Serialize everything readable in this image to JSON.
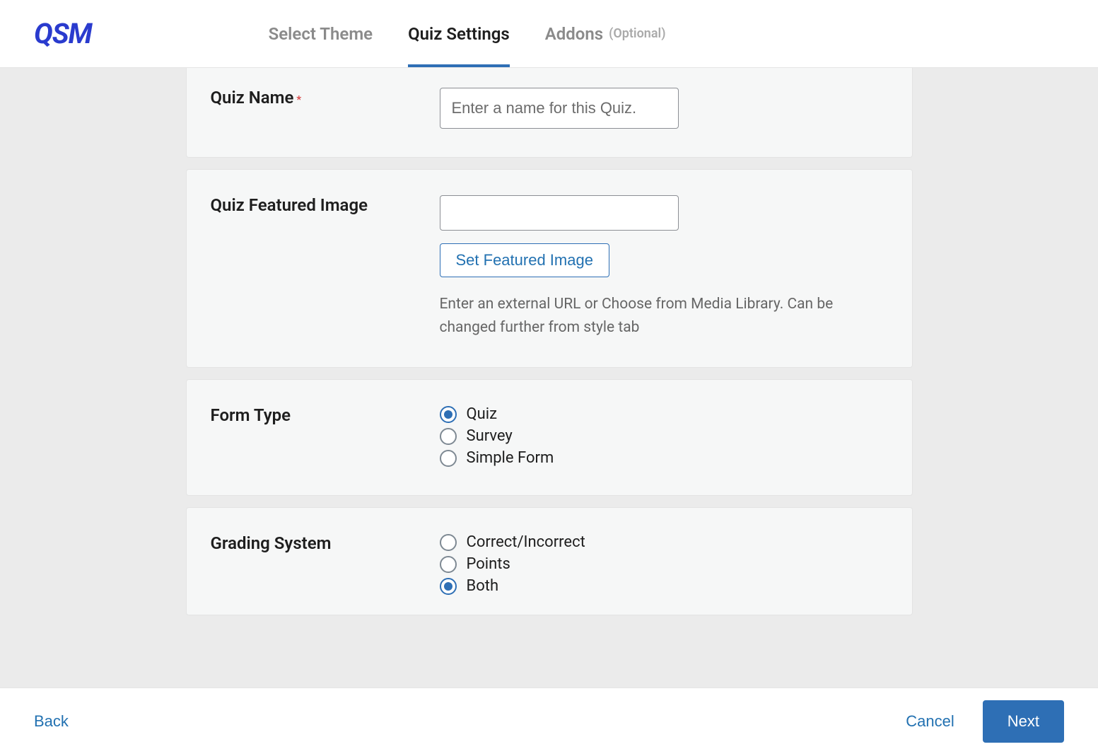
{
  "logo": "QSM",
  "tabs": {
    "select_theme": "Select Theme",
    "quiz_settings": "Quiz Settings",
    "addons": "Addons",
    "addons_hint": "(Optional)"
  },
  "fields": {
    "quiz_name": {
      "label": "Quiz Name",
      "placeholder": "Enter a name for this Quiz.",
      "value": ""
    },
    "featured_image": {
      "label": "Quiz Featured Image",
      "value": "",
      "button": "Set Featured Image",
      "help": "Enter an external URL or Choose from Media Library. Can be changed further from style tab"
    },
    "form_type": {
      "label": "Form Type",
      "options": [
        "Quiz",
        "Survey",
        "Simple Form"
      ],
      "selected": 0
    },
    "grading_system": {
      "label": "Grading System",
      "options": [
        "Correct/Incorrect",
        "Points",
        "Both"
      ],
      "selected": 2
    }
  },
  "footer": {
    "back": "Back",
    "cancel": "Cancel",
    "next": "Next"
  }
}
